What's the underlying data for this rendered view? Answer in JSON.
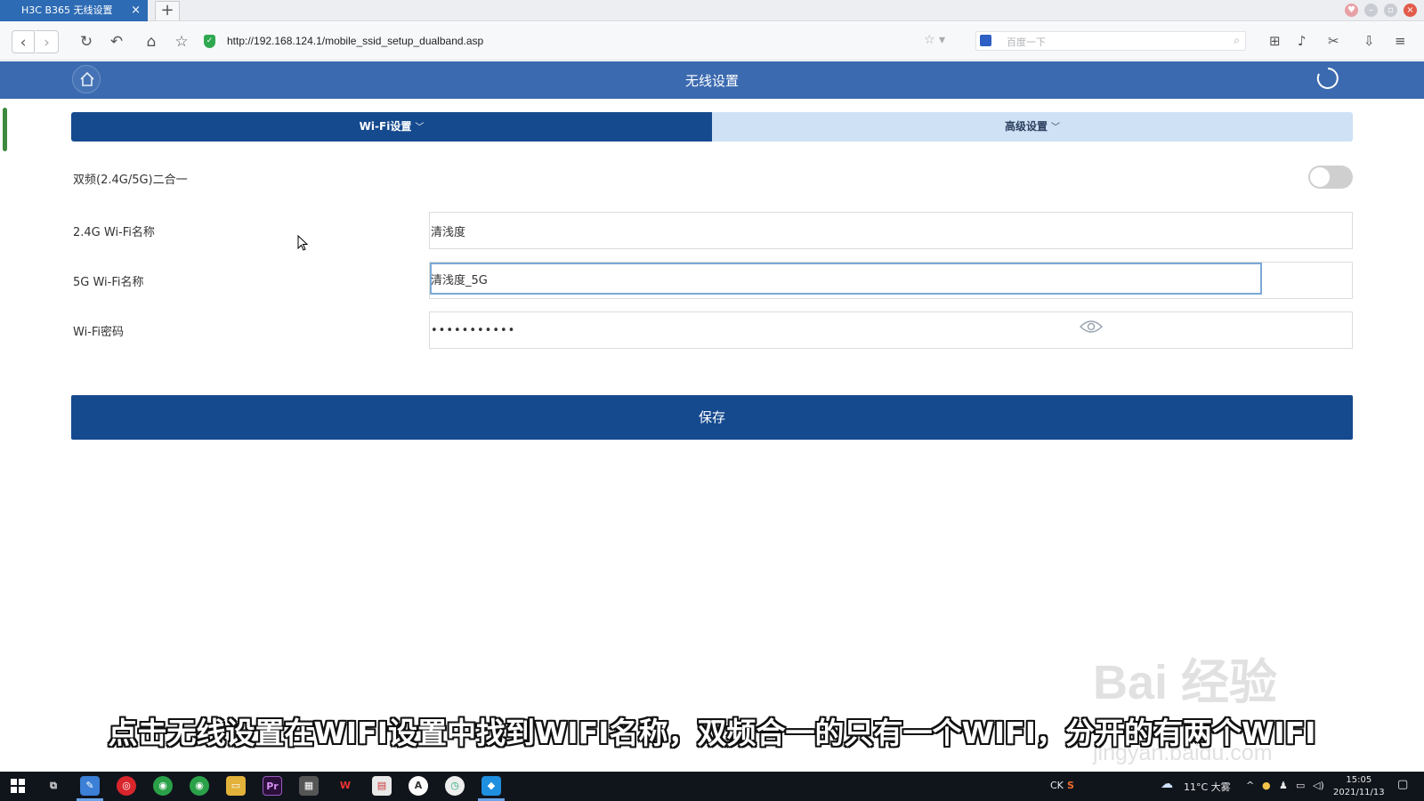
{
  "browser": {
    "tab_title": "H3C B365 无线设置",
    "tab_close": "×",
    "new_tab": "+",
    "url": "http://192.168.124.1/mobile_ssid_setup_dualband.asp",
    "search_placeholder": "百度一下"
  },
  "router": {
    "page_title": "无线设置",
    "tabs": [
      {
        "label": "Wi-Fi设置",
        "active": true
      },
      {
        "label": "高级设置",
        "active": false
      }
    ],
    "dualband_label": "双频(2.4G/5G)二合一",
    "dualband_enabled": false,
    "ssid_24_label": "2.4G Wi-Fi名称",
    "ssid_24_value": "清浅度",
    "ssid_5_label": "5G Wi-Fi名称",
    "ssid_5_value": "清浅度_5G",
    "password_label": "Wi-Fi密码",
    "password_value": "•••••••••••",
    "save_label": "保存"
  },
  "overlay": {
    "subtitle": "点击无线设置在WIFI设置中找到WIFI名称，双频合一的只有一个WIFI，分开的有两个WIFI",
    "watermark_main": "Bai 经验",
    "watermark_sub": "jingyan.baidu.com"
  },
  "taskbar": {
    "ime": "CK",
    "weather": "11°C 大雾",
    "time": "15:05",
    "date": "2021/11/13"
  },
  "colors": {
    "header": "#3b6ab0",
    "primary": "#164a8f",
    "tab_inactive": "#cfe1f5"
  }
}
